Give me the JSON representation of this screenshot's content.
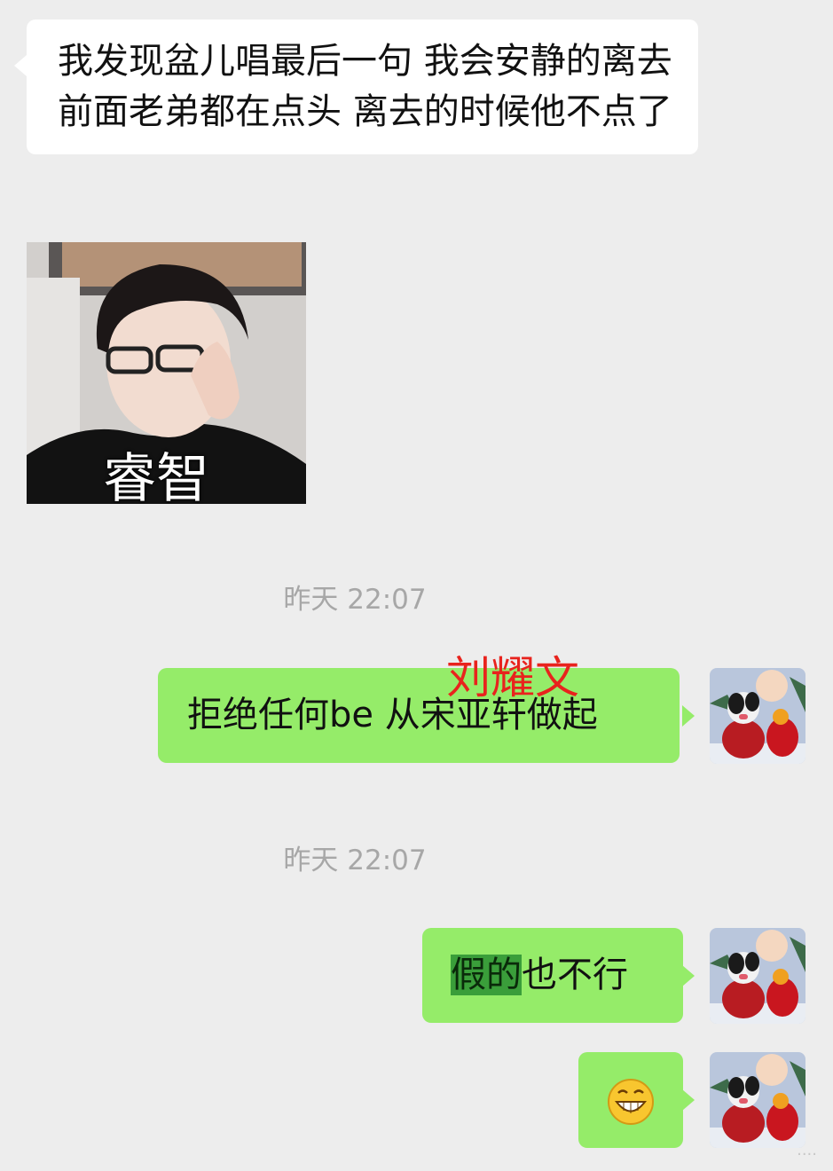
{
  "messages": {
    "m1": {
      "text": "我发现盆儿唱最后一句 我会安静的离去 前面老弟都在点头 离去的时候他不点了"
    },
    "sticker": {
      "caption": "睿智"
    },
    "ts1": "昨天 22:07",
    "m2": {
      "text": "拒绝任何be 从宋亚轩做起",
      "overlay_name": "刘耀文"
    },
    "ts2": "昨天 22:07",
    "m3": {
      "highlighted": "假的",
      "rest": "也不行"
    },
    "m4": {
      "emoji": "grinning-face-icon"
    }
  },
  "watermark": "····"
}
